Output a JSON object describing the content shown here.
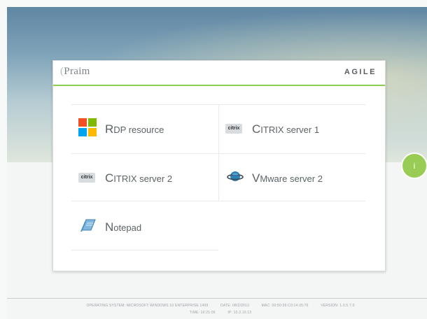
{
  "header": {
    "brand_left": "Praim",
    "brand_right": "AGILE"
  },
  "tiles": [
    {
      "label_cap": "R",
      "label_rest": "DP resource",
      "icon": "windows-logo-icon"
    },
    {
      "label_cap": "C",
      "label_rest": "ITRIX server 1",
      "icon": "citrix-icon"
    },
    {
      "label_cap": "C",
      "label_rest": "ITRIX server 2",
      "icon": "citrix-icon"
    },
    {
      "label_cap": "V",
      "label_rest": "Mware server 2",
      "icon": "vmware-icon"
    },
    {
      "label_cap": "N",
      "label_rest": "otepad",
      "icon": "notepad-icon"
    }
  ],
  "citrix_badge": "citrix",
  "side_button": {
    "label": "i",
    "color": "#98cc55"
  },
  "footer": {
    "os": "OPERATING SYSTEM: MICROSOFT WINDOWS 10 ENTERPRISE 1409",
    "date": "DATE: 08/2/2013",
    "mac": "MAC: 00:50:56:C0:14:35:76",
    "version": "VERSION: 1.0.5.7.0",
    "time": "TIME: 10:21:06",
    "ip": "IP: 10.3.10.13"
  },
  "colors": {
    "accent": "#8bcf52",
    "win_red": "#f25022",
    "win_green": "#7fba00",
    "win_blue": "#00a4ef",
    "win_yellow": "#ffb900"
  }
}
